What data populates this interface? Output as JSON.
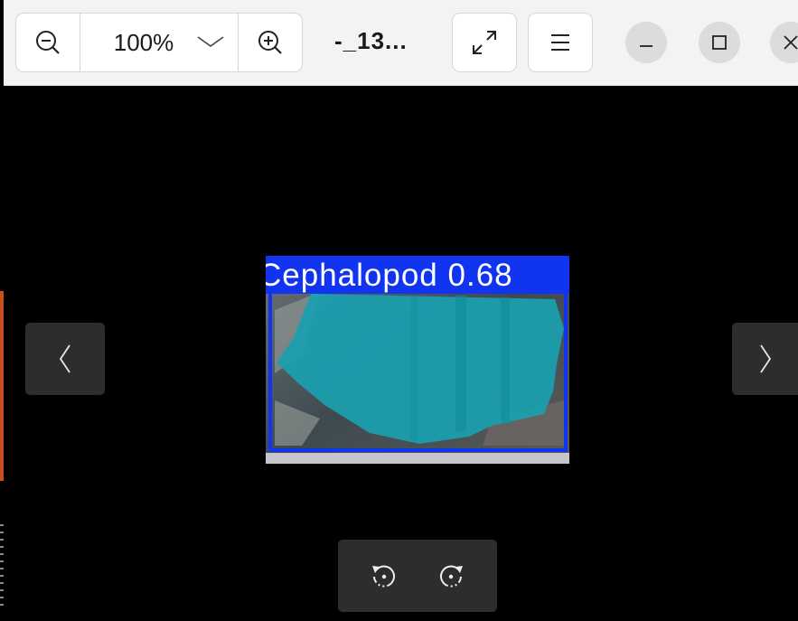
{
  "toolbar": {
    "zoom_value": "100%",
    "filename": "-_13...",
    "icons": {
      "zoom_out": "zoom-out-icon",
      "zoom_in": "zoom-in-icon",
      "zoom_dropdown": "chevron-down-icon",
      "fullscreen": "expand-icon",
      "menu": "hamburger-icon",
      "minimize": "minimize-icon",
      "maximize": "maximize-icon",
      "close": "close-icon"
    }
  },
  "image": {
    "detection_label": "Cephalopod 0.68",
    "box_color": "#1034f0",
    "mask_color": "#1aa0b0"
  },
  "navigation": {
    "prev_icon": "chevron-left-icon",
    "next_icon": "chevron-right-icon"
  },
  "rotate": {
    "left_icon": "rotate-left-icon",
    "right_icon": "rotate-right-icon"
  }
}
